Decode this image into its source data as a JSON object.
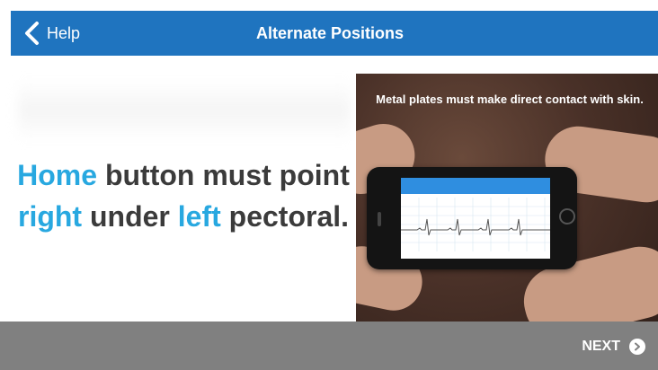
{
  "header": {
    "back_label": "Help",
    "title": "Alternate Positions"
  },
  "instruction": {
    "parts": [
      {
        "text": "Home",
        "highlight": true
      },
      {
        "text": " button must point ",
        "highlight": false
      },
      {
        "text": "right",
        "highlight": true
      },
      {
        "text": " under ",
        "highlight": false
      },
      {
        "text": "left",
        "highlight": true
      },
      {
        "text": " pectoral.",
        "highlight": false
      }
    ]
  },
  "photo": {
    "caption": "Metal plates must make direct contact with skin."
  },
  "footer": {
    "next_label": "NEXT"
  },
  "colors": {
    "header_bg": "#1f74bf",
    "highlight": "#28a8e0",
    "body_text": "#3b3b3b",
    "footer_bg": "#808080"
  }
}
